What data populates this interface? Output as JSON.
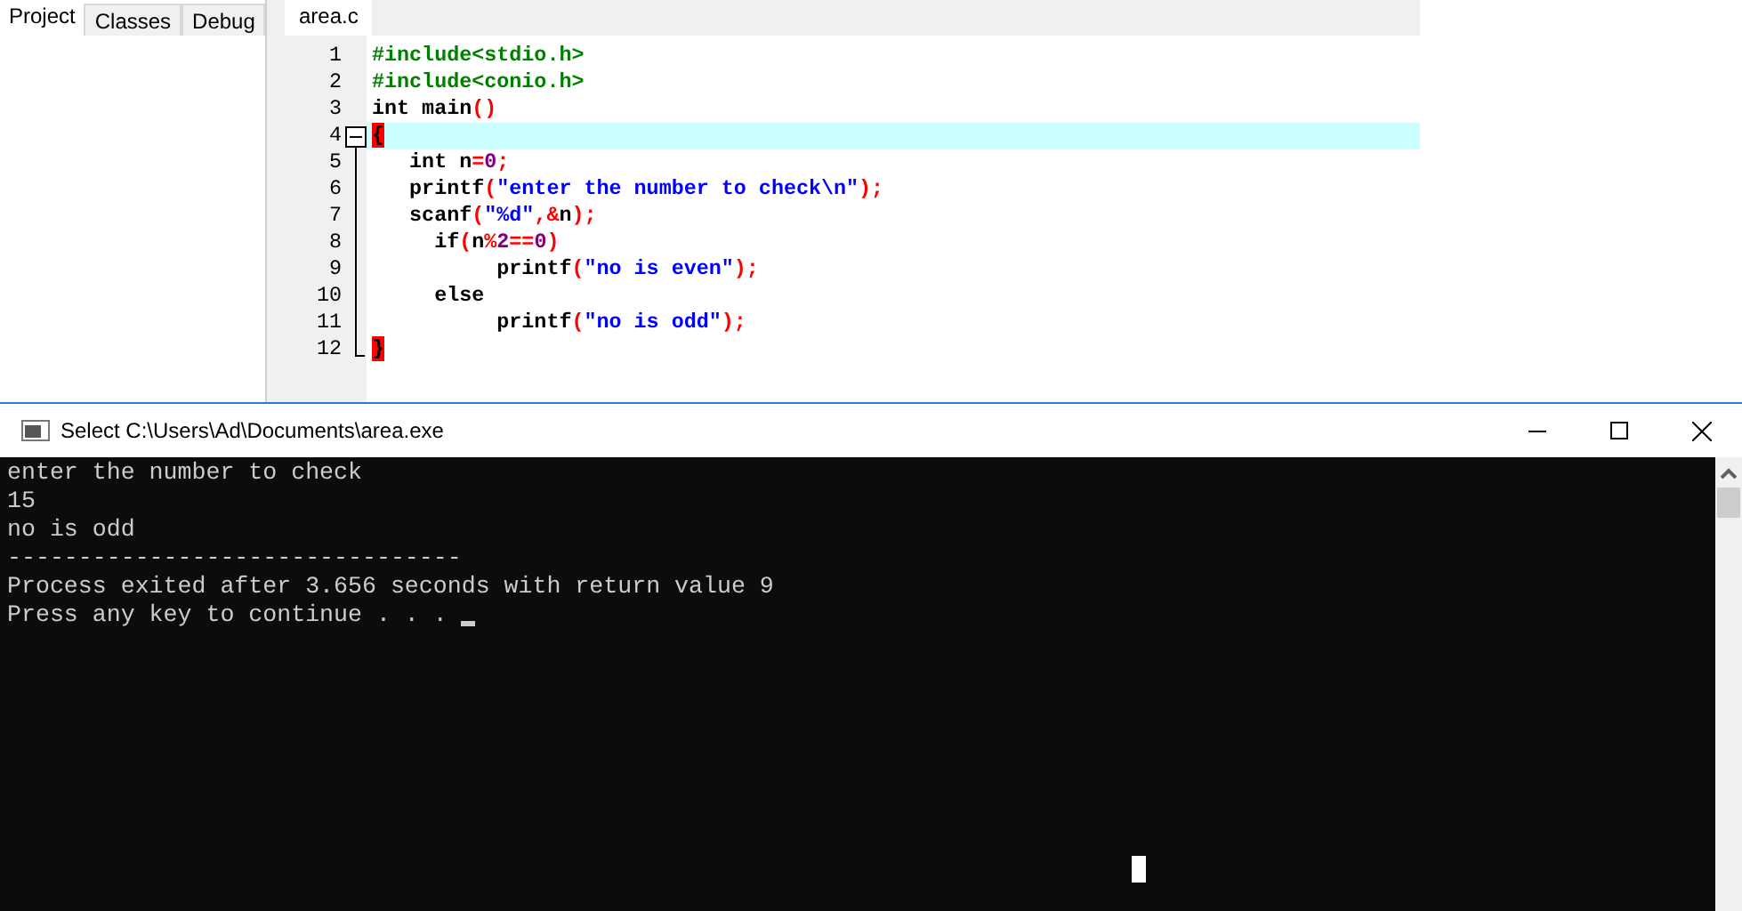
{
  "left_panel": {
    "tabs": [
      {
        "label": "Project",
        "selected": true
      },
      {
        "label": "Classes",
        "selected": false
      },
      {
        "label": "Debug",
        "selected": false
      }
    ]
  },
  "editor": {
    "tabs": [
      {
        "label": "area.c",
        "selected": true
      }
    ],
    "lines": [
      {
        "number": "1",
        "highlighted": false,
        "tokens": [
          {
            "kind": "directive",
            "text": "#include<stdio.h>"
          }
        ]
      },
      {
        "number": "2",
        "highlighted": false,
        "tokens": [
          {
            "kind": "directive",
            "text": "#include<conio.h>"
          }
        ]
      },
      {
        "number": "3",
        "highlighted": false,
        "tokens": [
          {
            "kind": "keyword",
            "text": "int"
          },
          {
            "kind": "ident",
            "text": " main"
          },
          {
            "kind": "symbol",
            "text": "()"
          }
        ]
      },
      {
        "number": "4",
        "highlighted": true,
        "fold": {
          "expanded": true
        },
        "tokens": [
          {
            "kind": "brace",
            "text": "{"
          }
        ]
      },
      {
        "number": "5",
        "highlighted": false,
        "tokens": [
          {
            "kind": "keyword",
            "text": "   int"
          },
          {
            "kind": "ident",
            "text": " n"
          },
          {
            "kind": "symbol",
            "text": "="
          },
          {
            "kind": "number",
            "text": "0"
          },
          {
            "kind": "symbol",
            "text": ";"
          }
        ]
      },
      {
        "number": "6",
        "highlighted": false,
        "tokens": [
          {
            "kind": "ident",
            "text": "   printf"
          },
          {
            "kind": "symbol",
            "text": "("
          },
          {
            "kind": "string",
            "text": "\"enter the number to check\\n\""
          },
          {
            "kind": "symbol",
            "text": ");"
          }
        ]
      },
      {
        "number": "7",
        "highlighted": false,
        "tokens": [
          {
            "kind": "ident",
            "text": "   scanf"
          },
          {
            "kind": "symbol",
            "text": "("
          },
          {
            "kind": "string",
            "text": "\"%d\""
          },
          {
            "kind": "symbol",
            "text": ",&"
          },
          {
            "kind": "ident",
            "text": "n"
          },
          {
            "kind": "symbol",
            "text": ");"
          }
        ]
      },
      {
        "number": "8",
        "highlighted": false,
        "tokens": [
          {
            "kind": "keyword",
            "text": "     if"
          },
          {
            "kind": "symbol",
            "text": "("
          },
          {
            "kind": "ident",
            "text": "n"
          },
          {
            "kind": "symbol",
            "text": "%"
          },
          {
            "kind": "number",
            "text": "2"
          },
          {
            "kind": "symbol",
            "text": "=="
          },
          {
            "kind": "number",
            "text": "0"
          },
          {
            "kind": "symbol",
            "text": ")"
          }
        ]
      },
      {
        "number": "9",
        "highlighted": false,
        "tokens": [
          {
            "kind": "ident",
            "text": "          printf"
          },
          {
            "kind": "symbol",
            "text": "("
          },
          {
            "kind": "string",
            "text": "\"no is even\""
          },
          {
            "kind": "symbol",
            "text": ");"
          }
        ]
      },
      {
        "number": "10",
        "highlighted": false,
        "tokens": [
          {
            "kind": "keyword",
            "text": "     else"
          }
        ]
      },
      {
        "number": "11",
        "highlighted": false,
        "tokens": [
          {
            "kind": "ident",
            "text": "          printf"
          },
          {
            "kind": "symbol",
            "text": "("
          },
          {
            "kind": "string",
            "text": "\"no is odd\""
          },
          {
            "kind": "symbol",
            "text": ");"
          }
        ]
      },
      {
        "number": "12",
        "highlighted": false,
        "tokens": [
          {
            "kind": "brace",
            "text": "}"
          }
        ]
      }
    ]
  },
  "console": {
    "title": "Select C:\\Users\\Ad\\Documents\\area.exe",
    "lines": [
      "enter the number to check",
      "15",
      "no is odd",
      "--------------------------------",
      "Process exited after 3.656 seconds with return value 9",
      "Press any key to continue . . ."
    ]
  }
}
